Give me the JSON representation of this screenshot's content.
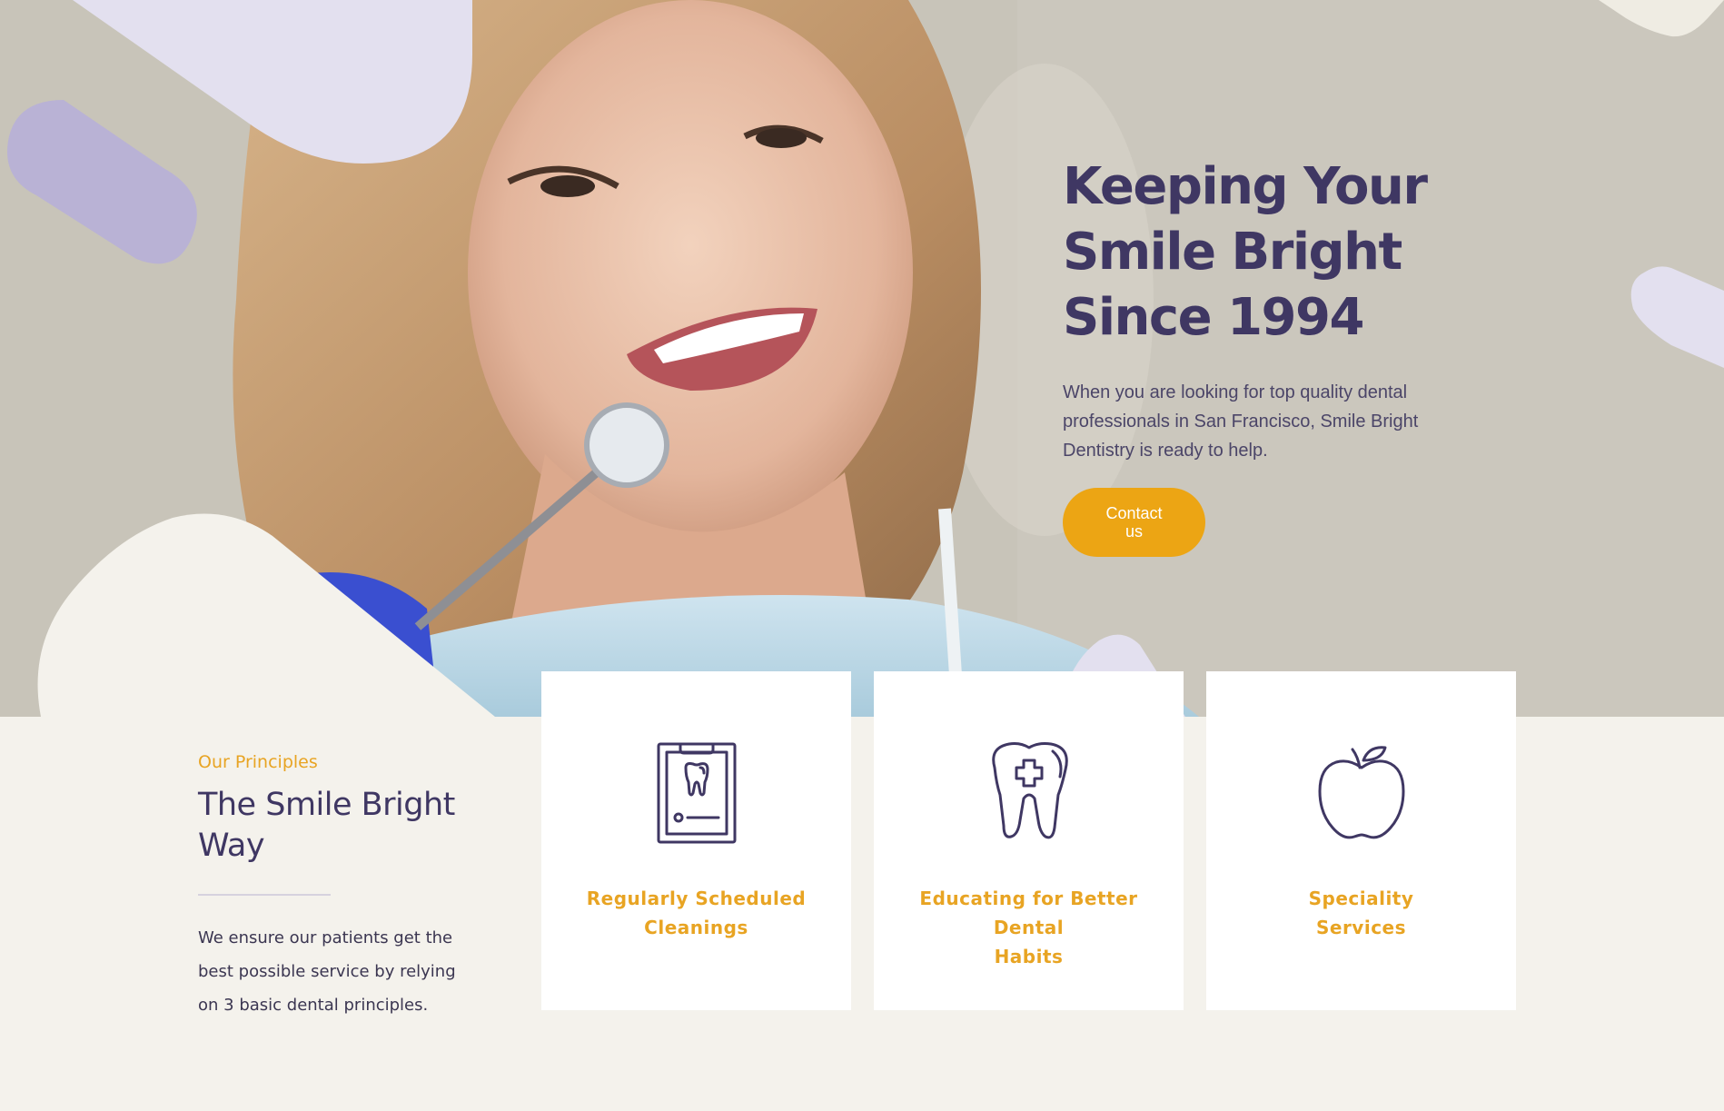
{
  "hero": {
    "title_lines": [
      "Keeping Your",
      "Smile Bright",
      "Since 1994"
    ],
    "description_lines": [
      "When you are looking for top quality dental",
      "professionals in San Francisco, Smile Bright",
      "Dentistry is ready to help."
    ],
    "cta_lines": [
      "Contact",
      "us"
    ]
  },
  "principles": {
    "eyebrow": "Our Principles",
    "title_lines": [
      "The Smile Bright",
      "Way"
    ],
    "description_lines": [
      "We ensure our patients get the",
      "best possible service by relying",
      "on 3 basic dental principles."
    ]
  },
  "cards": [
    {
      "icon": "tooth-clipboard-icon",
      "label_lines": [
        "Regularly Scheduled",
        "Cleanings"
      ]
    },
    {
      "icon": "tooth-cross-icon",
      "label_lines": [
        "Educating for Better Dental",
        "Habits"
      ]
    },
    {
      "icon": "apple-icon",
      "label_lines": [
        "Speciality",
        "Services"
      ]
    }
  ],
  "colors": {
    "primary": "#3f3763",
    "accent": "#eca514",
    "heading_accent": "#e8a423",
    "background": "#f4f2ec",
    "blob_light": "#e3e0ef",
    "blob_mid": "#b9b2d5"
  }
}
